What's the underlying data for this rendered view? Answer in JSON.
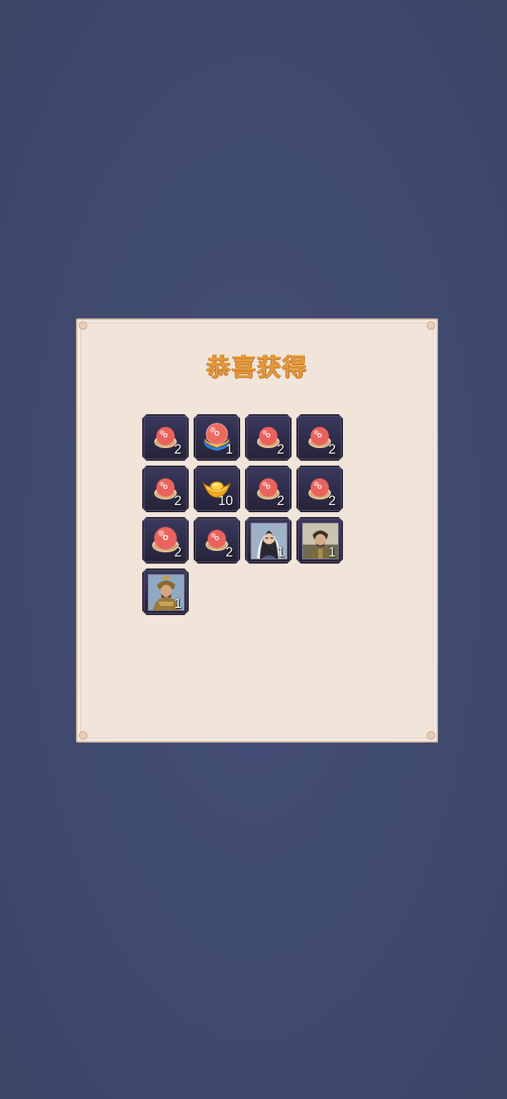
{
  "dialog": {
    "title": "恭喜获得"
  },
  "items": [
    {
      "icon": "peach-bun-icon",
      "count": "2"
    },
    {
      "icon": "rainbow-peach-bun-icon",
      "count": "1"
    },
    {
      "icon": "peach-bun-icon",
      "count": "2"
    },
    {
      "icon": "peach-bun-icon",
      "count": "2"
    },
    {
      "icon": "peach-bun-icon",
      "count": "2"
    },
    {
      "icon": "gold-ingot-icon",
      "count": "10"
    },
    {
      "icon": "peach-bun-icon",
      "count": "2"
    },
    {
      "icon": "peach-bun-icon",
      "count": "2"
    },
    {
      "icon": "large-peach-bun-icon",
      "count": "2"
    },
    {
      "icon": "peach-bun-icon",
      "count": "2"
    },
    {
      "icon": "veiled-heroine-portrait",
      "count": "1"
    },
    {
      "icon": "warrior-portrait",
      "count": "1"
    },
    {
      "icon": "general-portrait",
      "count": "1"
    }
  ],
  "colors": {
    "background": "#414b70",
    "panel": "#f1e4d9",
    "title": "#e39a3c",
    "slot": "#2f2c4a"
  }
}
